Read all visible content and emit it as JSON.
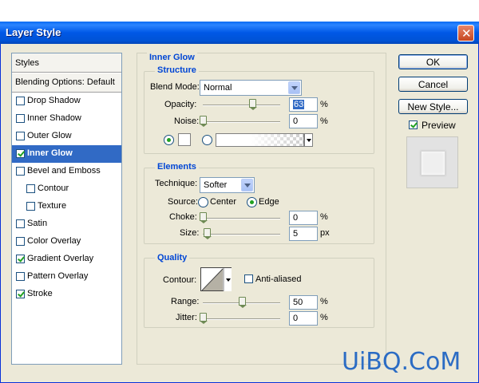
{
  "window": {
    "title": "Layer Style"
  },
  "styles_list": {
    "header": "Styles",
    "blending_options": "Blending Options: Default",
    "items": [
      {
        "label": "Drop Shadow",
        "checked": false,
        "selected": false
      },
      {
        "label": "Inner Shadow",
        "checked": false,
        "selected": false
      },
      {
        "label": "Outer Glow",
        "checked": false,
        "selected": false
      },
      {
        "label": "Inner Glow",
        "checked": true,
        "selected": true
      },
      {
        "label": "Bevel and Emboss",
        "checked": false,
        "selected": false
      },
      {
        "label": "Contour",
        "checked": false,
        "selected": false
      },
      {
        "label": "Texture",
        "checked": false,
        "selected": false
      },
      {
        "label": "Satin",
        "checked": false,
        "selected": false
      },
      {
        "label": "Color Overlay",
        "checked": false,
        "selected": false
      },
      {
        "label": "Gradient Overlay",
        "checked": true,
        "selected": false
      },
      {
        "label": "Pattern Overlay",
        "checked": false,
        "selected": false
      },
      {
        "label": "Stroke",
        "checked": true,
        "selected": false
      }
    ]
  },
  "inner_glow": {
    "title": "Inner Glow",
    "structure": {
      "title": "Structure",
      "blend_mode_label": "Blend Mode:",
      "blend_mode_value": "Normal",
      "opacity_label": "Opacity:",
      "opacity_value": "63",
      "opacity_unit": "%",
      "opacity_fraction": 0.63,
      "noise_label": "Noise:",
      "noise_value": "0",
      "noise_unit": "%",
      "noise_fraction": 0.0
    },
    "elements": {
      "title": "Elements",
      "technique_label": "Technique:",
      "technique_value": "Softer",
      "source_label": "Source:",
      "source_center": "Center",
      "source_edge": "Edge",
      "choke_label": "Choke:",
      "choke_value": "0",
      "choke_unit": "%",
      "size_label": "Size:",
      "size_value": "5",
      "size_unit": "px"
    },
    "quality": {
      "title": "Quality",
      "contour_label": "Contour:",
      "anti_aliased_label": "Anti-aliased",
      "range_label": "Range:",
      "range_value": "50",
      "range_unit": "%",
      "jitter_label": "Jitter:",
      "jitter_value": "0",
      "jitter_unit": "%"
    }
  },
  "buttons": {
    "ok": "OK",
    "cancel": "Cancel",
    "new_style": "New Style...",
    "preview_label": "Preview"
  },
  "watermark": "UiBQ.CoM",
  "colors": {
    "title_bar": "#0058E6",
    "selection": "#316AC5",
    "group_title": "#0046D5",
    "dialog_bg": "#ECE9D8"
  }
}
